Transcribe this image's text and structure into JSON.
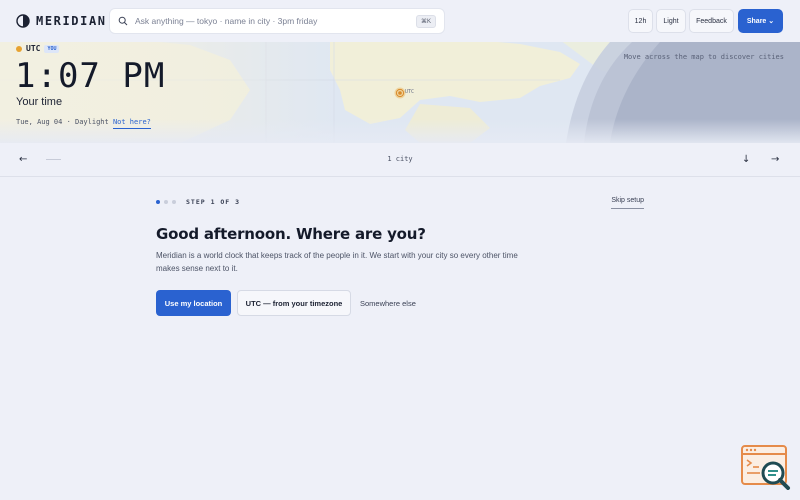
{
  "app": {
    "name": "MERIDIAN"
  },
  "search": {
    "placeholder": "Ask anything — tokyo · name in city · 3pm friday",
    "shortcut": "⌘K"
  },
  "toolbar": {
    "hour_format_label": "12h",
    "theme_label": "Light",
    "feedback_label": "Feedback",
    "share_label": "Share ⌄"
  },
  "hero": {
    "timezone": "UTC",
    "you_badge": "YOU",
    "time": "1:07 PM",
    "subtitle": "Your time",
    "date_line": "Tue, Aug 04 · Daylight",
    "not_here": "Not here?",
    "map_hint": "Move across the map to discover cities",
    "marker_label": "UTC"
  },
  "strip": {
    "city_count": "1 city"
  },
  "onboarding": {
    "step_label": "STEP 1 OF 3",
    "skip_label": "Skip setup",
    "heading": "Good afternoon. Where are you?",
    "body": "Meridian is a world clock that keeps track of the people in it. We start with your city so every other time makes sense next to it.",
    "primary_action": "Use my location",
    "secondary_action": "UTC — from your timezone",
    "tertiary_action": "Somewhere else"
  },
  "colors": {
    "accent": "#2a62d0",
    "sun": "#e7a331",
    "background": "#eef0f8"
  },
  "icons": {
    "logo": "half-circle-icon",
    "search": "search-icon",
    "corner": "browser-search-icon"
  }
}
